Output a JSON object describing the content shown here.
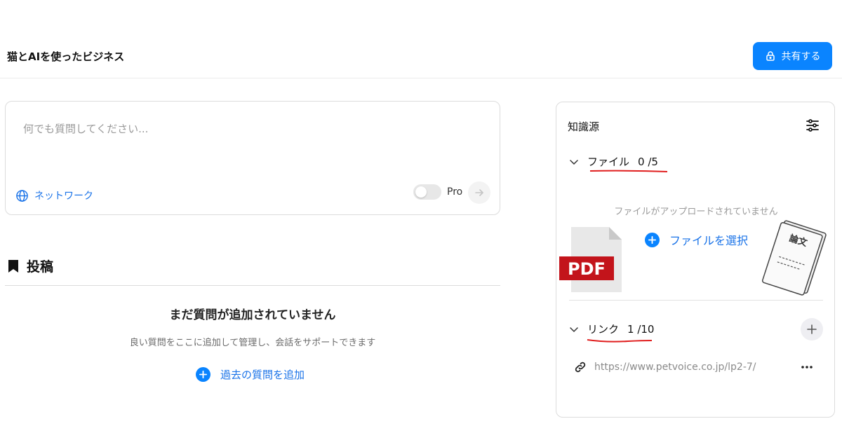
{
  "header": {
    "title": "猫とAIを使ったビジネス",
    "share_label": "共有する"
  },
  "ask": {
    "placeholder": "何でも質問してください...",
    "network_label": "ネットワーク",
    "pro_label": "Pro"
  },
  "posts": {
    "title": "投稿",
    "empty_title": "まだ質問が追加されていません",
    "empty_desc": "良い質問をここに追加して管理し、会話をサポートできます",
    "add_past_label": "過去の質問を追加"
  },
  "knowledge": {
    "title": "知識源",
    "files_label": "ファイル",
    "files_count": "0 /5",
    "no_files_text": "ファイルがアップロードされていません",
    "select_file_label": "ファイルを選択",
    "links_label": "リンク",
    "links_count": "1 /10",
    "links": [
      {
        "url": "https://www.petvoice.co.jp/lp2-7/"
      }
    ]
  },
  "illustrations": {
    "pdf_text": "PDF",
    "paper_text": "論文"
  },
  "colors": {
    "accent": "#0a84ff",
    "link": "#1a73e8",
    "annotation": "#e01e1e"
  }
}
